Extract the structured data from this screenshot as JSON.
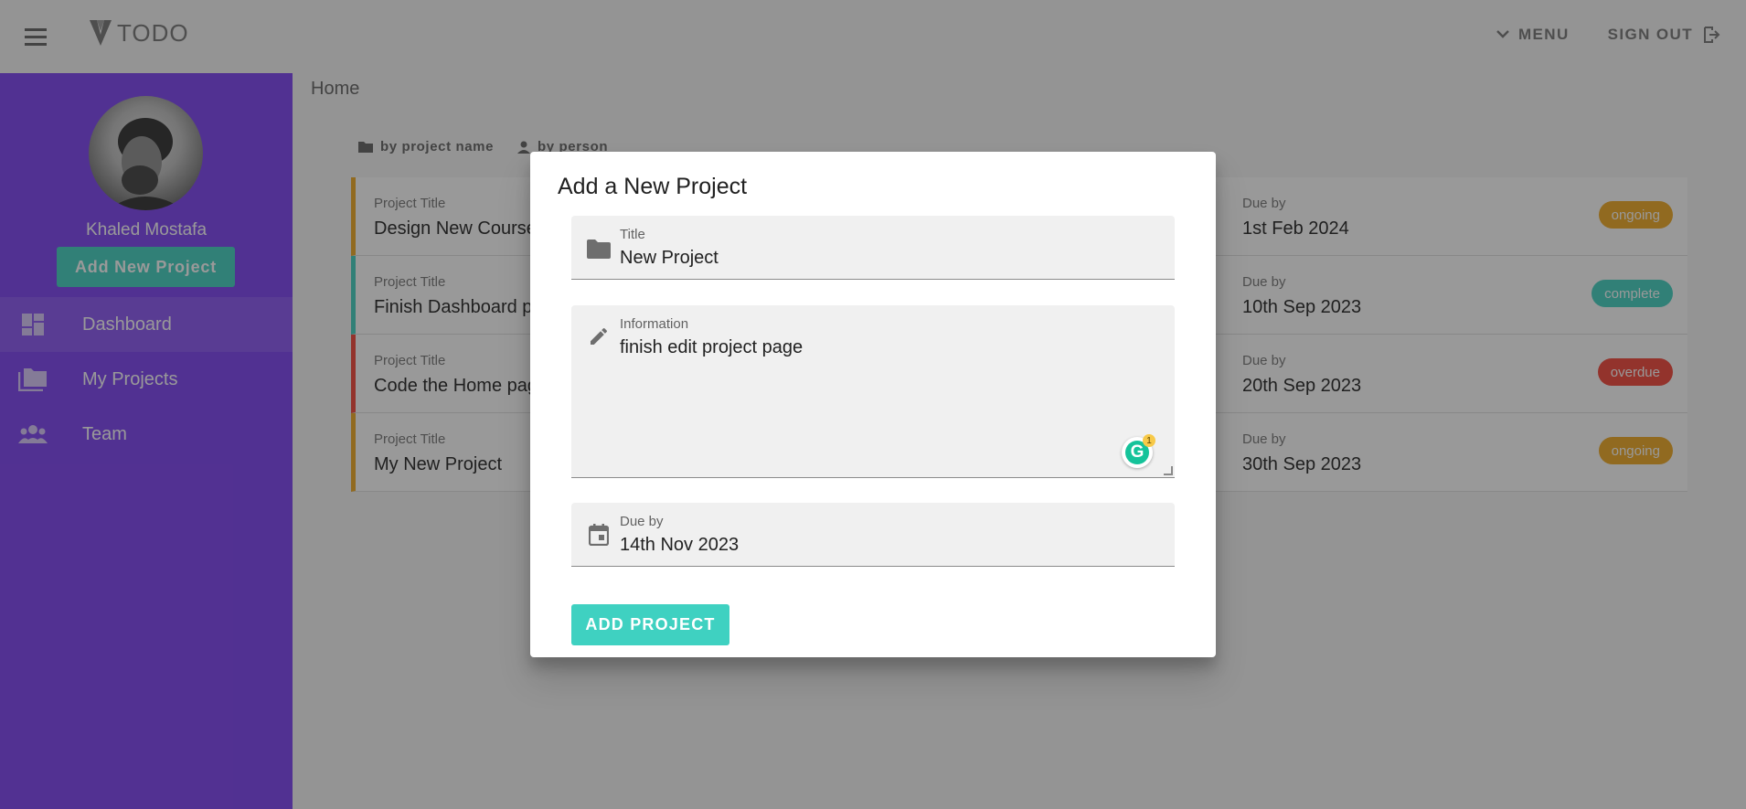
{
  "app": {
    "logo_text": "TODO"
  },
  "topbar": {
    "menu_label": "MENU",
    "signout_label": "SIGN OUT"
  },
  "sidebar": {
    "user_name": "Khaled Mostafa",
    "add_button": "Add New Project",
    "items": [
      {
        "label": "Dashboard",
        "icon": "dashboard-icon",
        "active": true
      },
      {
        "label": "My Projects",
        "icon": "folders-icon",
        "active": false
      },
      {
        "label": "Team",
        "icon": "team-icon",
        "active": false
      }
    ]
  },
  "main": {
    "breadcrumb": "Home",
    "sort": {
      "by_project": "by project name",
      "by_person": "by person"
    },
    "projects": [
      {
        "title_label": "Project Title",
        "title": "Design New Course",
        "due_label": "Due by",
        "due": "1st Feb 2024",
        "status": "ongoing"
      },
      {
        "title_label": "Project Title",
        "title": "Finish Dashboard pa",
        "due_label": "Due by",
        "due": "10th Sep 2023",
        "status": "complete"
      },
      {
        "title_label": "Project Title",
        "title": "Code the Home pag",
        "due_label": "Due by",
        "due": "20th Sep 2023",
        "status": "overdue"
      },
      {
        "title_label": "Project Title",
        "title": "My New Project",
        "due_label": "Due by",
        "due": "30th Sep 2023",
        "status": "ongoing"
      }
    ]
  },
  "dialog": {
    "title": "Add a New Project",
    "title_field": {
      "label": "Title",
      "value": "New Project"
    },
    "info_field": {
      "label": "Information",
      "value": "finish edit project page"
    },
    "due_field": {
      "label": "Due by",
      "value": "14th Nov 2023"
    },
    "grammarly_count": "1",
    "submit_label": "ADD PROJECT"
  },
  "colors": {
    "sidebar": "#7b3ff2",
    "accent": "#3fd1c1",
    "ongoing": "#f0a820",
    "complete": "#3fd1c1",
    "overdue": "#f44336"
  }
}
